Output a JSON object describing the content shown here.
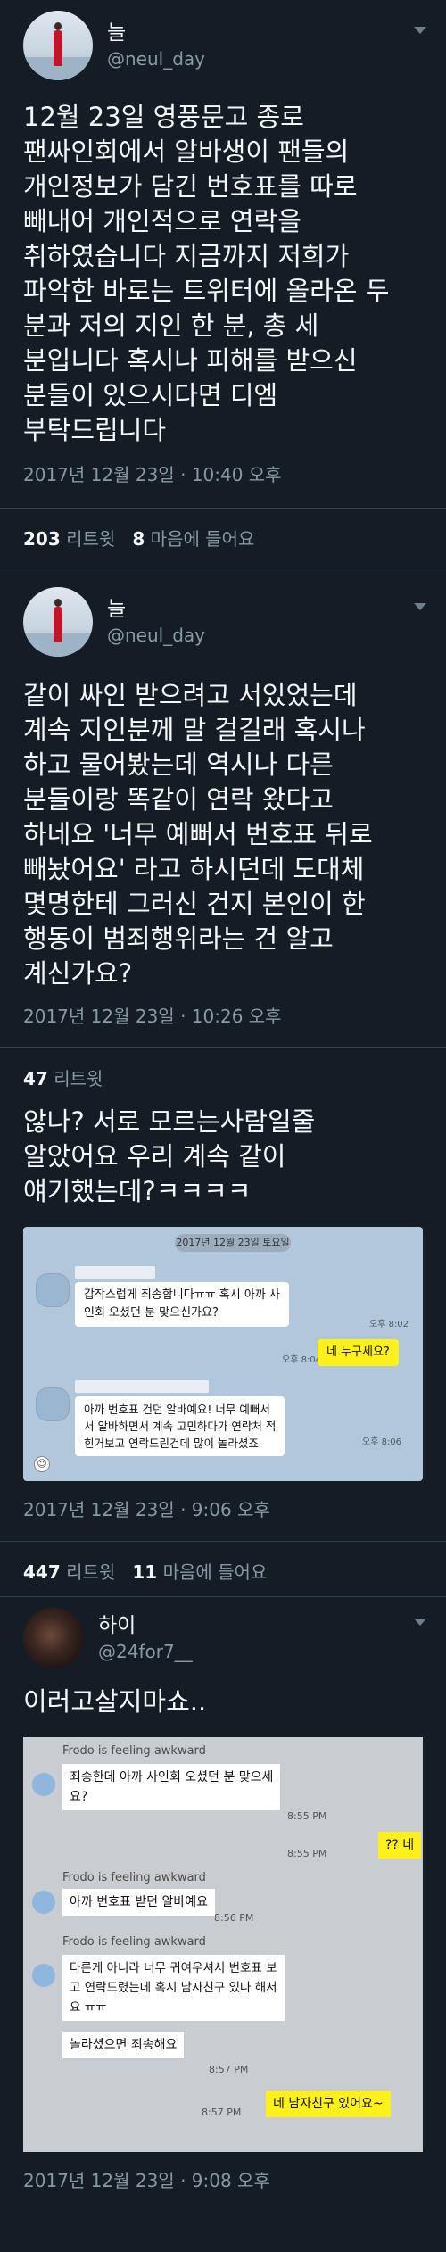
{
  "tweet1": {
    "display_name": "늘",
    "handle": "@neul_day",
    "text": "12월 23일 영풍문고 종로\n팬싸인회에서 알바생이 팬들의\n개인정보가 담긴 번호표를 따로\n빼내어 개인적으로 연락을\n취하였습니다 지금까지 저희가\n파악한 바로는 트위터에 올라온 두\n분과 저의 지인 한 분, 총 세\n분입니다 혹시나 피해를 받으신\n분들이 있으시다면 디엠\n부탁드립니다",
    "timestamp": "2017년 12월 23일 · 10:40 오후",
    "retweets": "203",
    "retweets_label": "리트윗",
    "likes": "8",
    "likes_label": "마음에 들어요"
  },
  "tweet2": {
    "display_name": "늘",
    "handle": "@neul_day",
    "text": "같이 싸인 받으려고 서있었는데\n계속 지인분께 말 걸길래 혹시나\n하고 물어봤는데 역시나 다른\n분들이랑 똑같이 연락 왔다고\n하네요 '너무 예뻐서 번호표 뒤로\n빼놨어요' 라고 하시던데 도대체\n몇명한테 그러신 건지 본인이 한\n행동이 범죄행위라는 건 알고\n계신가요?",
    "timestamp": "2017년 12월 23일 · 10:26 오후",
    "retweets": "47",
    "retweets_label": "리트윗"
  },
  "tweet3": {
    "text": "않나? 서로 모르는사람일줄\n알았어요 우리 계속 같이\n얘기했는데?ㅋㅋㅋㅋ",
    "kakao": {
      "date": "2017년 12월 23일 토요일",
      "msg1": "갑작스럽게 죄송합니다ㅠㅠ 혹시 아까 사\n인회 오셨던 분 맞으신가요?",
      "time1": "오후 8:02",
      "time2": "오후 8:04",
      "reply1": "네 누구세요?",
      "msg2": "아까 번호표 건던 알바예요! 너무 예뻐서\n서 알바하면서 계속 고민하다가 연락처 적\n힌거보고 연락드린건데 많이 놀라셨죠",
      "time3": "오후 8:06",
      "emoji_icon": "smile-icon"
    },
    "timestamp": "2017년 12월 23일 · 9:06 오후",
    "retweets": "447",
    "retweets_label": "리트윗",
    "likes": "11",
    "likes_label": "마음에 들어요"
  },
  "tweet4": {
    "display_name": "하이",
    "handle": "@24for7__",
    "text": "이러고살지마쇼..",
    "fb": {
      "feeling": "Frodo is feeling awkward",
      "msg1": "죄송한데 아까 사인회 오셨던 분 맞으세\n요?",
      "time1": "8:55 PM",
      "reply1": "?? 네",
      "time2": "8:55 PM",
      "msg2": "아까 번호표 받던 알바예요",
      "time3": "8:56 PM",
      "msg3": "다른게 아니라 너무 귀여우셔서 번호표 보\n고  연락드렸는데 혹시 남자친구 있나 해서\n요 ㅠㅠ",
      "msg4": "놀라셨으면 죄송해요",
      "time4": "8:57 PM",
      "time5": "8:57 PM",
      "reply2": "네 남자친구 있어요~"
    },
    "timestamp": "2017년 12월 23일 · 9:08 오후"
  },
  "colors": {
    "background": "#141d26",
    "text": "#f5f8fa",
    "muted": "#8899a6",
    "kakao_yellow": "#fef01b"
  }
}
